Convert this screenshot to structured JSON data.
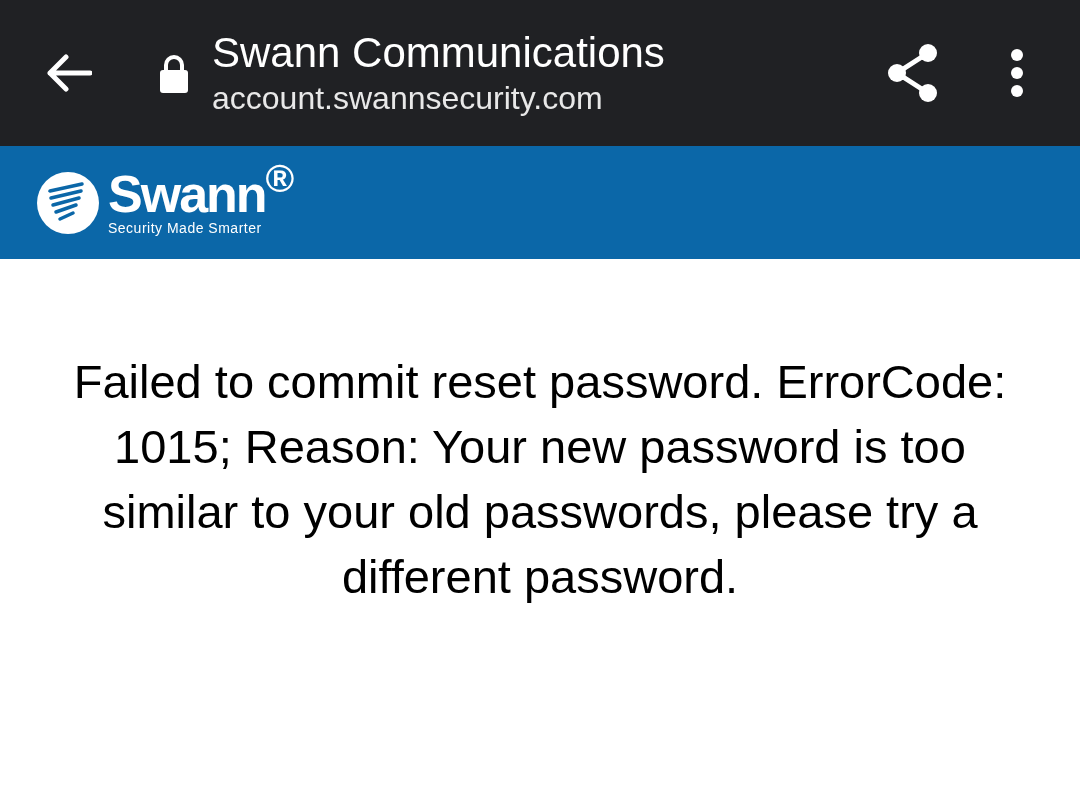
{
  "browser_bar": {
    "title": "Swann Communications",
    "url": "account.swannsecurity.com"
  },
  "header": {
    "logo": {
      "wordmark": "Swann$^{®}$",
      "tagline": "Security Made Smarter"
    }
  },
  "message": "Failed to commit reset password. ErrorCode: 1015; Reason: Your new password is too similar to your old passwords, please try a different password."
}
